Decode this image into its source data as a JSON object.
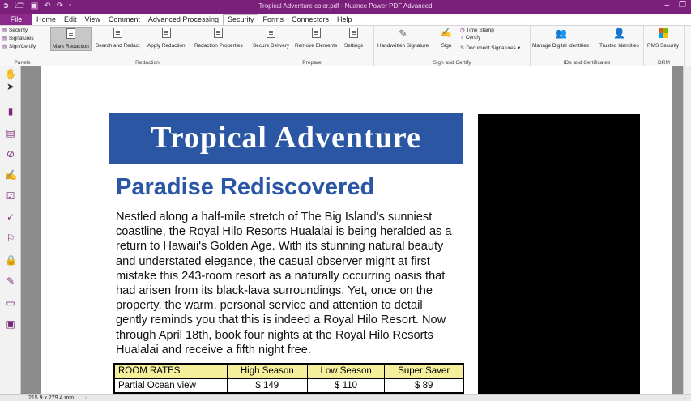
{
  "titlebar": {
    "title": "Tropical Adventure color.pdf - Nuance Power PDF Advanced",
    "qat_icons": [
      "app-logo-icon",
      "open-icon",
      "save-icon",
      "undo-icon",
      "redo-icon",
      "customize-icon"
    ]
  },
  "menubar": {
    "items": [
      "File",
      "Home",
      "Edit",
      "View",
      "Comment",
      "Advanced Processing",
      "Security",
      "Forms",
      "Connectors",
      "Help"
    ],
    "active": "Security"
  },
  "ribbon": {
    "panels": {
      "label": "Panels",
      "items": [
        "Security",
        "Signatures",
        "Sign/Certify"
      ]
    },
    "redaction": {
      "label": "Redaction",
      "buttons": [
        "Mark Redaction",
        "Search and Redact",
        "Apply Redaction",
        "Redaction Properties"
      ]
    },
    "prepare": {
      "label": "Prepare",
      "buttons": [
        "Secure Delivery",
        "Remove Elements",
        "Settings"
      ]
    },
    "sign_certify": {
      "label": "Sign and Certify",
      "buttons": [
        "Handwritten Signature",
        "Sign"
      ],
      "small": [
        "Time Stamp",
        "Certify",
        "Document Signatures"
      ]
    },
    "ids": {
      "label": "IDs and Certificates",
      "buttons": [
        "Manage Digital Identities",
        "Trusted Identities"
      ]
    },
    "drm": {
      "label": "DRM",
      "buttons": [
        "RMS Security"
      ]
    }
  },
  "toolstrip": {
    "tools": [
      "hand-icon",
      "select-arrow-icon",
      "bookmarks-icon",
      "pages-icon",
      "attachments-icon",
      "signatures-panel-icon",
      "form-fields-icon",
      "checkmark-icon",
      "stamp-icon",
      "security-lock-icon",
      "handwritten-signature-icon",
      "comments-icon",
      "redaction-panel-icon"
    ]
  },
  "document": {
    "banner": "Tropical Adventure",
    "heading": "Paradise Rediscovered",
    "body_lines": [
      "Nestled along a half-mile stretch of The Big Island's sunniest",
      "coastline, the Royal Hilo Resorts Hualalai is being heralded as a",
      "return to Hawaii's Golden Age. With its stunning natural beauty",
      "and understated elegance, the casual observer might at first",
      "mistake this 243-room resort as a naturally occurring oasis that",
      "had arisen from its black-lava surroundings. Yet, once on the",
      "property, the warm, personal service and attention to detail",
      "gently reminds you that this is indeed a Royal Hilo Resort. Now",
      "through April 18th, book four nights at the Royal Hilo Resorts",
      "Hualalai and receive a fifth night free."
    ],
    "rates_table": {
      "headers": [
        "ROOM RATES",
        "High Season",
        "Low Season",
        "Super Saver"
      ],
      "rows": [
        [
          "Partial Ocean view",
          "$ 149",
          "$ 110",
          "$ 89"
        ]
      ]
    }
  },
  "statusbar": {
    "page_size": "215.9 x 279.4 mm"
  },
  "colors": {
    "accent": "#7a1f7a",
    "banner": "#2a56a3",
    "table_header": "#f5ef9c"
  }
}
